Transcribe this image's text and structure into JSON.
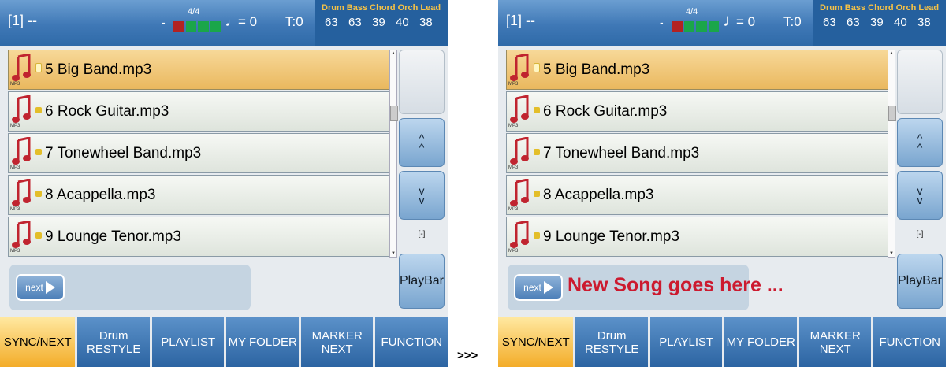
{
  "header": {
    "slot": "[1] --",
    "dot": "-",
    "time_signature": "4/4",
    "tempo": "= 0",
    "transpose": "T:0",
    "mixer_labels": [
      "Drum",
      "Bass",
      "Chord",
      "Orch",
      "Lead"
    ],
    "mixer_values": [
      "63",
      "63",
      "39",
      "40",
      "38"
    ]
  },
  "songs": [
    {
      "label": "5 Big Band.mp3",
      "selected": true
    },
    {
      "label": "6 Rock Guitar.mp3",
      "selected": false
    },
    {
      "label": "7 Tonewheel Band.mp3",
      "selected": false
    },
    {
      "label": "8 Acappella.mp3",
      "selected": false
    },
    {
      "label": "9 Lounge Tenor.mp3",
      "selected": false
    }
  ],
  "file_type_badge": "MP3",
  "side": {
    "up": [
      "^",
      "^"
    ],
    "down": [
      "v",
      "v"
    ],
    "chain": "[-]",
    "playbar": "PlayBar"
  },
  "next_button": "next",
  "next_song_left": "",
  "next_song_right": "New Song goes here ...",
  "tabs": [
    {
      "l1": "SYNC/NEXT",
      "l2": "",
      "active": true
    },
    {
      "l1": "Drum",
      "l2": "RESTYLE",
      "active": false
    },
    {
      "l1": "PLAYLIST",
      "l2": "",
      "active": false
    },
    {
      "l1": "MY FOLDER",
      "l2": "",
      "active": false
    },
    {
      "l1": "MARKER",
      "l2": "NEXT",
      "active": false
    },
    {
      "l1": "FUNCTION",
      "l2": "",
      "active": false
    }
  ],
  "transition": ">>>",
  "colors": {
    "accent": "#cc1a2f",
    "header": "#3f78b6",
    "selected_row": "#eab85e",
    "active_tab": "#f3ac28"
  }
}
